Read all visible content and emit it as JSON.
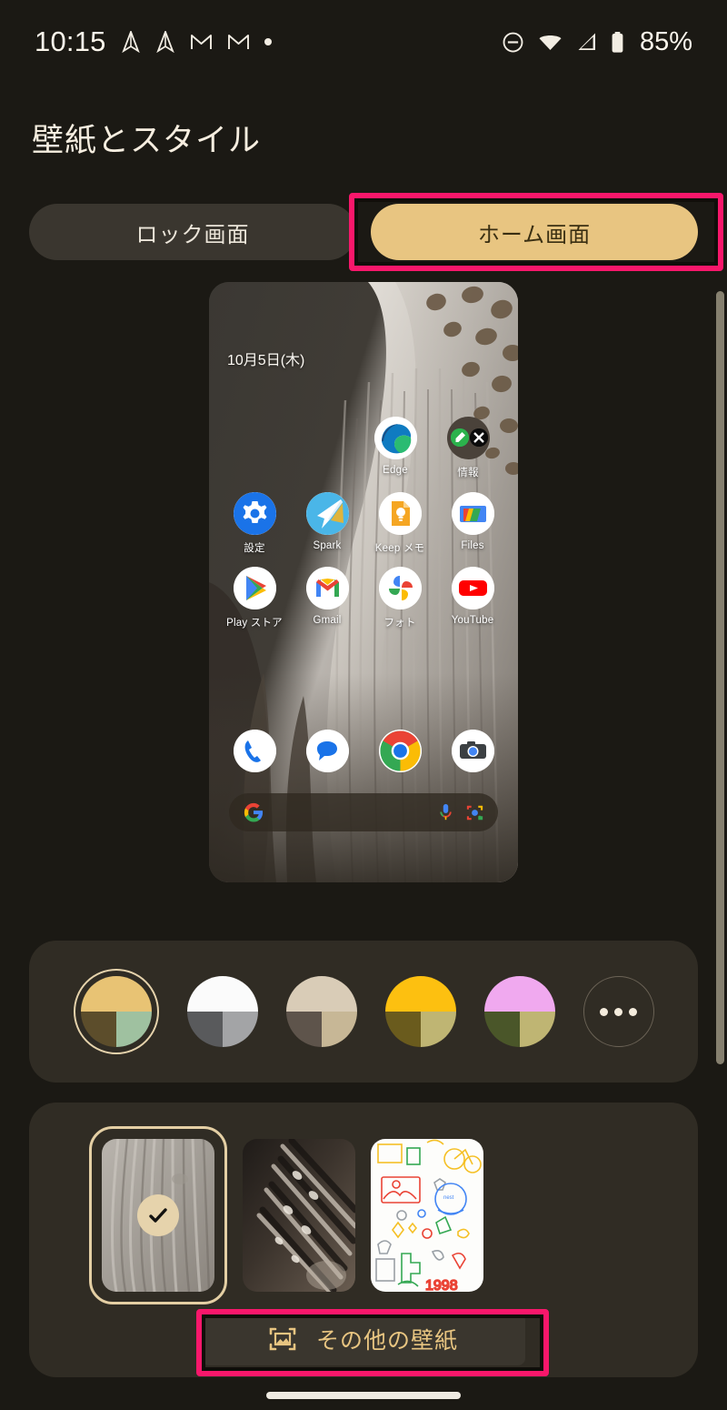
{
  "statusbar": {
    "clock": "10:15",
    "battery_percent": "85%",
    "left_icons": [
      "spark-plane-icon",
      "spark-plane-icon",
      "gmail-m-icon",
      "gmail-m-icon",
      "dot-icon"
    ],
    "right_icons": [
      "do-not-disturb-icon",
      "wifi-icon",
      "cellular-signal-icon",
      "battery-icon"
    ]
  },
  "header": {
    "title": "壁紙とスタイル"
  },
  "tabs": [
    {
      "label": "ロック画面",
      "selected": false
    },
    {
      "label": "ホーム画面",
      "selected": true
    }
  ],
  "annotations": {
    "color": "#f8176b",
    "targets": [
      "home-screen-tab",
      "more-wallpapers-button"
    ]
  },
  "preview": {
    "date": "10月5日(木)",
    "rows": [
      [
        {
          "label": "Edge",
          "icon": "edge-icon"
        },
        {
          "label": "情報",
          "icon": "folder-icon",
          "folder_apps": [
            "feedly-icon",
            "x-twitter-icon"
          ]
        }
      ],
      [
        {
          "label": "設定",
          "icon": "settings-gear-icon"
        },
        {
          "label": "Spark",
          "icon": "spark-icon"
        },
        {
          "label": "Keep メモ",
          "icon": "google-keep-icon"
        },
        {
          "label": "Files",
          "icon": "files-icon"
        }
      ],
      [
        {
          "label": "Play ストア",
          "icon": "play-store-icon"
        },
        {
          "label": "Gmail",
          "icon": "gmail-icon"
        },
        {
          "label": "フォト",
          "icon": "google-photos-icon"
        },
        {
          "label": "YouTube",
          "icon": "youtube-icon"
        }
      ]
    ],
    "dock": [
      {
        "label": "",
        "icon": "phone-icon"
      },
      {
        "label": "",
        "icon": "messages-icon"
      },
      {
        "label": "",
        "icon": "chrome-icon"
      },
      {
        "label": "",
        "icon": "camera-icon"
      }
    ],
    "searchbar": {
      "leading_icon": "google-g-icon",
      "trailing_icons": [
        "microphone-icon",
        "google-lens-icon"
      ],
      "placeholder": ""
    }
  },
  "color_panel": {
    "swatches": [
      {
        "name": "swatch-gold-sage",
        "top": "#e8c374",
        "bottom_left": "#5c4d2b",
        "bottom_right": "#9fc1a0",
        "selected": true
      },
      {
        "name": "swatch-white-gray",
        "top": "#fbfbfb",
        "bottom_left": "#595a5c",
        "bottom_right": "#a3a4a6",
        "selected": false
      },
      {
        "name": "swatch-beige-brown",
        "top": "#d9ccb7",
        "bottom_left": "#5e544b",
        "bottom_right": "#c7b796",
        "selected": false
      },
      {
        "name": "swatch-yellow-olive",
        "top": "#fdc010",
        "bottom_left": "#6a5b1d",
        "bottom_right": "#bfb573",
        "selected": false
      },
      {
        "name": "swatch-pink-green",
        "top": "#f0a9ef",
        "bottom_left": "#4a5629",
        "bottom_right": "#bfb573",
        "selected": false
      },
      {
        "name": "swatch-more",
        "more": true,
        "selected": false
      }
    ],
    "more_icon": "three-dots-icon"
  },
  "wallpaper_panel": {
    "thumbnails": [
      {
        "name": "wallpaper-feather-light",
        "selected": true,
        "check_icon": "check-icon"
      },
      {
        "name": "wallpaper-feather-dark",
        "selected": false
      },
      {
        "name": "wallpaper-doodle-white",
        "selected": false
      }
    ],
    "more_button": {
      "label": "その他の壁紙",
      "icon": "image-frame-icon"
    }
  },
  "navigation": {
    "home_pill": "home-gesture-pill"
  },
  "theme": {
    "page_background": "#1b1914",
    "panel_background": "#302c24",
    "accent": "#e8c581",
    "text_primary": "#f6eee0",
    "tab_inactive_bg": "#3a362f"
  }
}
